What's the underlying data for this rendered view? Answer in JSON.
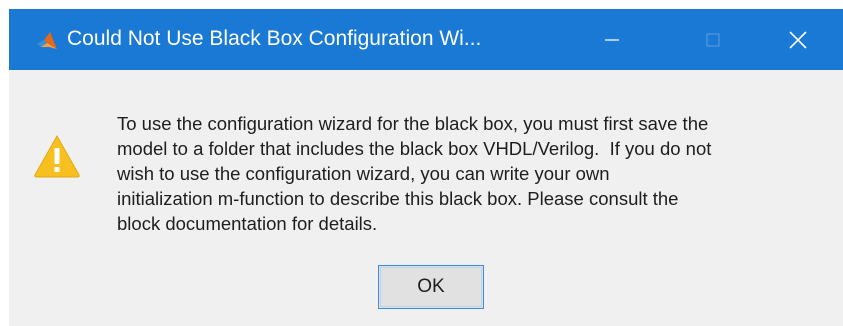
{
  "window": {
    "title": "Could Not Use Black Box Configuration Wi..."
  },
  "titlebar": {
    "app_icon": "matlab-logo-icon",
    "minimize_icon": "minimize-icon",
    "maximize_icon": "maximize-icon",
    "close_icon": "close-icon",
    "color": "#1a79d4"
  },
  "dialog": {
    "icon": "warning-icon",
    "message_lines": [
      "To use the configuration wizard for the black box, you must first save the",
      "model to a folder that includes the black box VHDL/Verilog.  If you do not",
      "wish to use the configuration wizard, you can write your own",
      "initialization m-function to describe this black box. Please consult the",
      "block documentation for details."
    ],
    "ok_label": "OK"
  }
}
